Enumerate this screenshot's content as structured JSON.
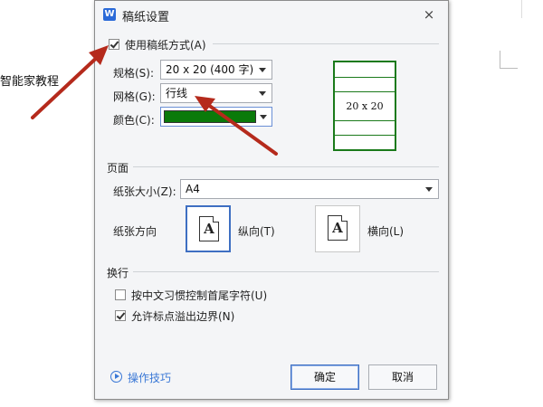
{
  "background": {
    "text": "智能家教程"
  },
  "dialog": {
    "title": "稿纸设置",
    "app_icon": "W",
    "close_glyph": "×",
    "use_grid": {
      "label": "使用稿纸方式(A)",
      "checked": true
    },
    "spec": {
      "label": "规格(S):",
      "value": "20 x 20 (400 字)"
    },
    "grid": {
      "label": "网格(G):",
      "value": "行线"
    },
    "color": {
      "label": "颜色(C):",
      "value": "#0a7a0a"
    },
    "preview": {
      "label": "20 x 20"
    },
    "page_section": {
      "title": "页面",
      "paper_size": {
        "label": "纸张大小(Z):",
        "value": "A4"
      },
      "orientation_label": "纸张方向",
      "portrait": {
        "label": "纵向(T)",
        "letter": "A",
        "selected": true
      },
      "landscape": {
        "label": "横向(L)",
        "letter": "A",
        "selected": false
      }
    },
    "wrap_section": {
      "title": "换行",
      "option1": {
        "label": "按中文习惯控制首尾字符(U)",
        "checked": false
      },
      "option2": {
        "label": "允许标点溢出边界(N)",
        "checked": true
      }
    },
    "tips": "操作技巧",
    "ok": "确定",
    "cancel": "取消"
  },
  "annotation_color": "#b52a1c"
}
